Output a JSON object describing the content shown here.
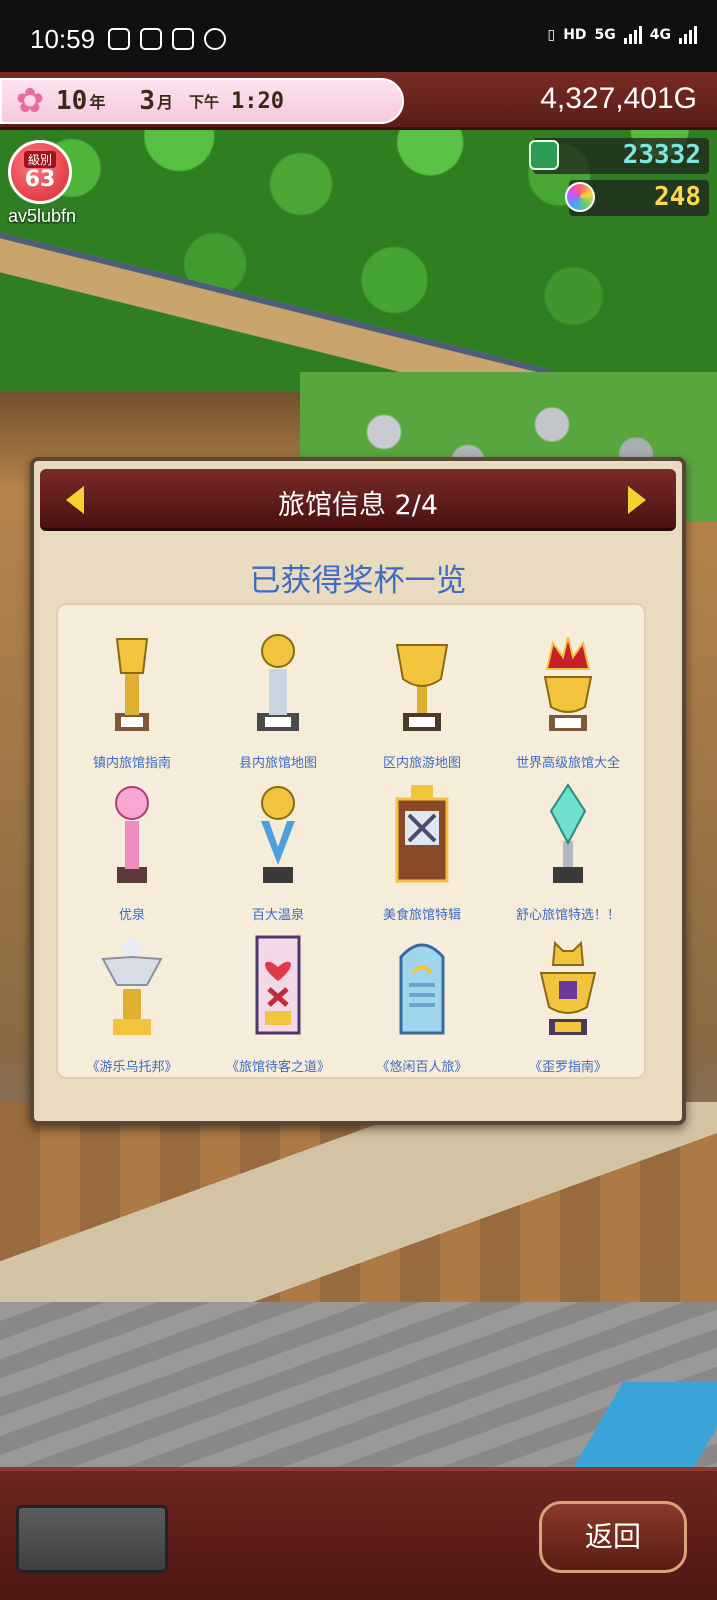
{
  "status_bar": {
    "time": "10:59",
    "network_5g": "5G",
    "network_4g": "4G",
    "hd": "HD"
  },
  "hud": {
    "year_value": "10",
    "year_unit": "年",
    "month_value": "3",
    "month_unit": "月",
    "ampm": "下午",
    "clock": "1:20",
    "gold": "4,327,401G",
    "level_label": "級別",
    "level": "63",
    "player_name": "av5lubfn",
    "tickets": "23332",
    "spring_points": "248"
  },
  "dialog": {
    "title": "旅馆信息 2/4",
    "section_title": "已获得奖杯一览",
    "trophies": [
      {
        "name": "镇内旅馆指南",
        "icon": "gold-torch-trophy-icon"
      },
      {
        "name": "县内旅馆地图",
        "icon": "gold-silver-torch-trophy-icon"
      },
      {
        "name": "区内旅游地图",
        "icon": "gold-cup-trophy-icon"
      },
      {
        "name": "世界高级旅馆大全",
        "icon": "crown-cup-trophy-icon"
      },
      {
        "name": "优泉",
        "icon": "pink-onsen-trophy-icon"
      },
      {
        "name": "百大温泉",
        "icon": "blue-ribbon-globe-trophy-icon"
      },
      {
        "name": "美食旅馆特辑",
        "icon": "food-plaque-trophy-icon"
      },
      {
        "name": "舒心旅馆特选！！",
        "icon": "crystal-trophy-icon"
      },
      {
        "name": "《游乐乌托邦》",
        "icon": "angel-statue-trophy-icon"
      },
      {
        "name": "《旅馆待客之道》",
        "icon": "heart-ribbon-plaque-icon"
      },
      {
        "name": "《悠闲百人旅》",
        "icon": "blue-onsen-plaque-icon"
      },
      {
        "name": "《歪罗指南》",
        "icon": "cat-cup-trophy-icon"
      }
    ]
  },
  "bottom": {
    "back_label": "返回"
  },
  "colors": {
    "accent_blue": "#3f6bc2",
    "header_red": "#5a1d18",
    "arrow_yellow": "#f4d22e"
  }
}
